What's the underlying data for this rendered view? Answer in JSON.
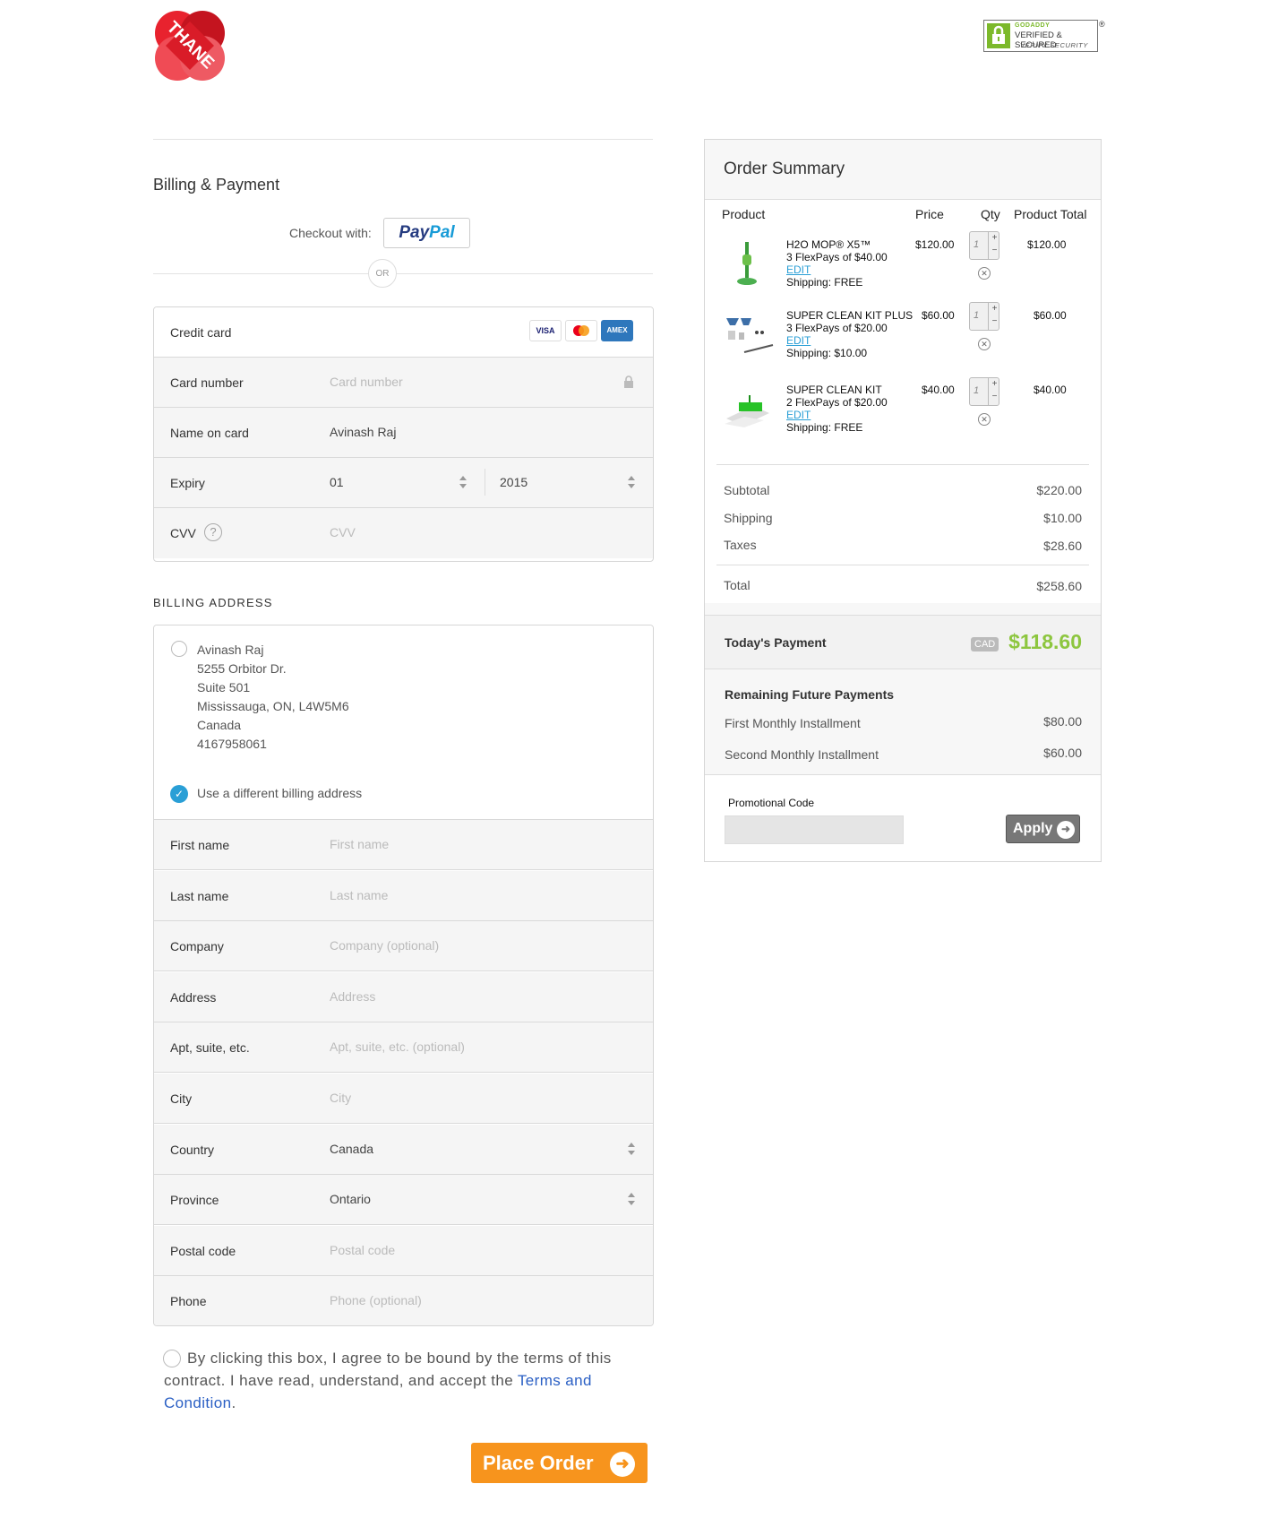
{
  "header": {
    "logo_text": "THANE",
    "badge": {
      "line1": "GODADDY",
      "line2": "VERIFIED & SECURED",
      "line3": "VERIFY SECURITY",
      "reg": "®"
    }
  },
  "billing": {
    "title": "Billing & Payment",
    "checkout_with": "Checkout with:",
    "paypal": {
      "pay": "Pay",
      "pal": "Pal"
    },
    "or": "OR"
  },
  "credit_card": {
    "title": "Credit card",
    "brands": [
      "VISA",
      "MC",
      "AMEX"
    ],
    "card_number": {
      "label": "Card number",
      "placeholder": "Card number"
    },
    "name_on_card": {
      "label": "Name on card",
      "value": "Avinash Raj"
    },
    "expiry": {
      "label": "Expiry",
      "month": "01",
      "year": "2015"
    },
    "cvv": {
      "label": "CVV",
      "placeholder": "CVV",
      "help": "?"
    }
  },
  "billing_address": {
    "heading": "BILLING ADDRESS",
    "saved": [
      "Avinash Raj",
      "5255 Orbitor Dr.",
      "Suite 501",
      "Mississauga, ON, L4W5M6",
      "Canada",
      "4167958061"
    ],
    "different_label": "Use a different billing address",
    "fields": [
      {
        "label": "First name",
        "placeholder": "First name"
      },
      {
        "label": "Last name",
        "placeholder": "Last name"
      },
      {
        "label": "Company",
        "placeholder": "Company (optional)"
      },
      {
        "label": "Address",
        "placeholder": "Address"
      },
      {
        "label": "Apt, suite, etc.",
        "placeholder": "Apt, suite, etc. (optional)"
      },
      {
        "label": "City",
        "placeholder": "City"
      },
      {
        "label": "Country",
        "value": "Canada"
      },
      {
        "label": "Province",
        "value": "Ontario"
      },
      {
        "label": "Postal code",
        "placeholder": "Postal code"
      },
      {
        "label": "Phone",
        "placeholder": "Phone (optional)"
      }
    ]
  },
  "terms": {
    "text": "By clicking this box, I agree to be bound by the terms of this contract. I have read, understand, and accept the ",
    "link": "Terms and Condition",
    "end": "."
  },
  "place_order": "Place Order",
  "summary": {
    "title": "Order Summary",
    "columns": {
      "product": "Product",
      "price": "Price",
      "qty": "Qty",
      "total": "Product Total"
    },
    "items": [
      {
        "name": "H2O MOP® X5™",
        "flex": "3 FlexPays of $40.00",
        "edit": "EDIT",
        "shipping": "Shipping: FREE",
        "price": "$120.00",
        "qty": "1",
        "total": "$120.00"
      },
      {
        "name": "SUPER CLEAN KIT PLUS",
        "flex": "3 FlexPays of $20.00",
        "edit": "EDIT",
        "shipping": "Shipping: $10.00",
        "price": "$60.00",
        "qty": "1",
        "total": "$60.00"
      },
      {
        "name": "SUPER CLEAN KIT",
        "flex": "2 FlexPays of $20.00",
        "edit": "EDIT",
        "shipping": "Shipping: FREE",
        "price": "$40.00",
        "qty": "1",
        "total": "$40.00"
      }
    ],
    "subtotal": {
      "label": "Subtotal",
      "value": "$220.00"
    },
    "shipping": {
      "label": "Shipping",
      "value": "$10.00"
    },
    "taxes": {
      "label": "Taxes",
      "value": "$28.60"
    },
    "total": {
      "label": "Total",
      "value": "$258.60"
    },
    "today": {
      "label": "Today's Payment",
      "currency": "CAD",
      "value": "$118.60"
    },
    "future": {
      "heading": "Remaining Future Payments",
      "first": {
        "label": "First Monthly Installment",
        "value": "$80.00"
      },
      "second": {
        "label": "Second Monthly Installment",
        "value": "$60.00"
      }
    },
    "promo": {
      "label": "Promotional Code",
      "apply": "Apply"
    }
  },
  "colors": {
    "accent": "#f7941d",
    "brand_red": "#e8222e",
    "green": "#8dc63f",
    "link": "#2a9fd6"
  }
}
